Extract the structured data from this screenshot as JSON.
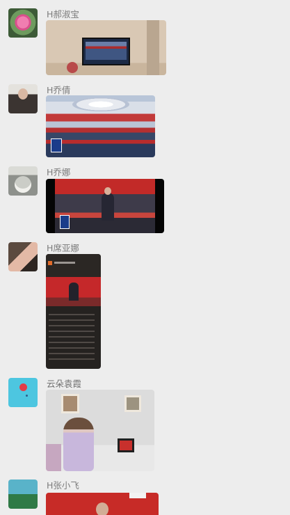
{
  "chat": {
    "messages": [
      {
        "sender": "H郝淑宝"
      },
      {
        "sender": "H乔倩"
      },
      {
        "sender": "H乔娜"
      },
      {
        "sender": "H席亚娜"
      },
      {
        "sender": "云朵袁霞"
      },
      {
        "sender": "H张小飞"
      }
    ]
  }
}
